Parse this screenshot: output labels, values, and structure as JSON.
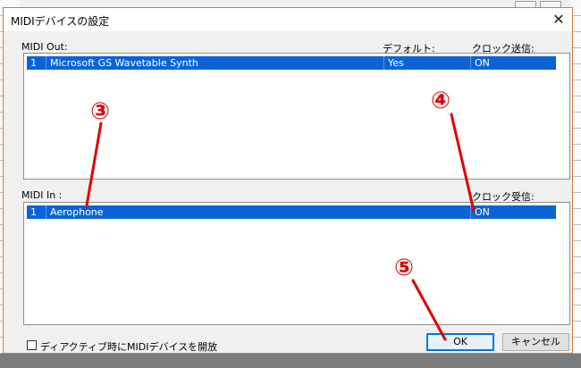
{
  "dialog": {
    "title": "MIDIデバイスの設定",
    "close_icon": "close-icon"
  },
  "midi_out": {
    "label": "MIDI Out:",
    "col_default": "デフォルト:",
    "col_clock_send": "クロック送信:",
    "rows": [
      {
        "index": "1",
        "name": "Microsoft GS Wavetable Synth",
        "default": "Yes",
        "clock": "ON"
      }
    ]
  },
  "midi_in": {
    "label": "MIDI In :",
    "col_clock_recv": "クロック受信:",
    "rows": [
      {
        "index": "1",
        "name": "Aerophone",
        "clock": "ON"
      }
    ]
  },
  "footer": {
    "release_checkbox_label": "ディアクティブ時にMIDIデバイスを開放",
    "ok_label": "OK",
    "cancel_label": "キャンセル"
  },
  "annotations": {
    "mark3": "③",
    "mark4": "④",
    "mark5": "⑤",
    "color": "#e00000"
  },
  "colors": {
    "selection": "#0a64d6",
    "accent_border": "#d07a3a"
  }
}
